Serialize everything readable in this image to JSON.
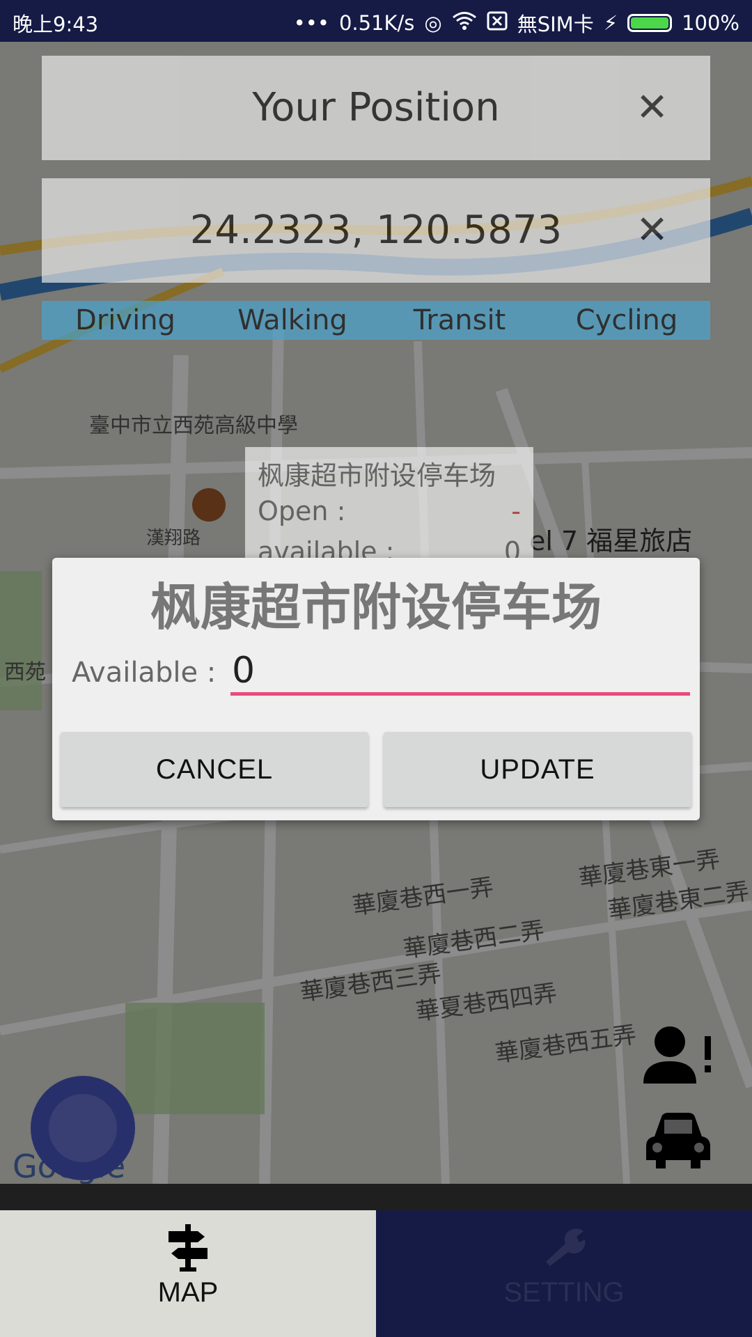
{
  "status_bar": {
    "time": "晚上9:43",
    "network_speed": "0.51K/s",
    "sim": "無SIM卡",
    "battery": "100%"
  },
  "origin_panel": {
    "text": "Your Position",
    "close_glyph": "✕"
  },
  "destination_panel": {
    "text": "24.2323, 120.5873",
    "close_glyph": "✕"
  },
  "travel_modes": [
    "Driving",
    "Walking",
    "Transit",
    "Cycling"
  ],
  "map_labels": {
    "school": "臺中市立西苑高級中學",
    "road1": "漢翔路",
    "hotel": "el 7 福星旅店",
    "west": "西苑",
    "lane1": "華廈巷西一弄",
    "lane2": "華廈巷西二弄",
    "lane3": "華廈巷西三弄",
    "lane4": "華夏巷西四弄",
    "lane5": "華廈巷西五弄",
    "laneE1": "華廈巷東一弄",
    "laneE2": "華廈巷東二弄",
    "google": "Google"
  },
  "info_window": {
    "title": "枫康超市附设停车场",
    "open_label": "Open :",
    "open_value": "-",
    "available_label": "available :",
    "available_value": "0"
  },
  "dialog": {
    "title": "枫康超市附设停车场",
    "available_label": "Available :",
    "available_value": "0",
    "cancel_label": "CANCEL",
    "update_label": "UPDATE"
  },
  "bottom_nav": {
    "map_label": "MAP",
    "setting_label": "SETTING"
  }
}
